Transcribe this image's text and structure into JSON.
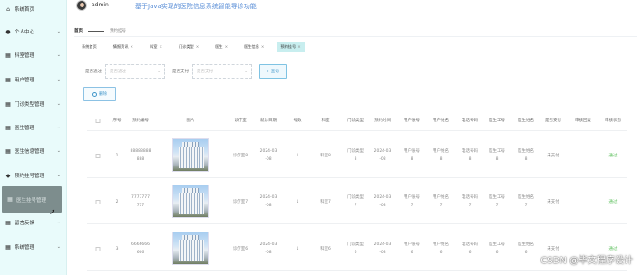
{
  "header": {
    "username": "admin",
    "app_title": "基于Java实现的医院信息系统智能导诊功能"
  },
  "sidebar": {
    "items": [
      {
        "label": "系统首页",
        "icon": "home-icon",
        "glyph": "⌂"
      },
      {
        "label": "个人中心",
        "icon": "user-icon",
        "glyph": "●"
      },
      {
        "label": "科室管理",
        "icon": "grid-icon",
        "glyph": "▦"
      },
      {
        "label": "用户管理",
        "icon": "grid-icon",
        "glyph": "▦"
      },
      {
        "label": "门诊类型管理",
        "icon": "grid-icon",
        "glyph": "▦"
      },
      {
        "label": "医生管理",
        "icon": "grid-icon",
        "glyph": "▦"
      },
      {
        "label": "医生信息管理",
        "icon": "grid-icon",
        "glyph": "▦"
      },
      {
        "label": "预约挂号管理",
        "icon": "bulb-icon",
        "glyph": "◆"
      },
      {
        "label": "医生挂号管理",
        "icon": "grid-icon",
        "glyph": "▦"
      },
      {
        "label": "留言反馈",
        "icon": "grid-icon",
        "glyph": "▦"
      },
      {
        "label": "系统管理",
        "icon": "grid-icon",
        "glyph": "▦"
      }
    ]
  },
  "breadcrumb": {
    "home": "首页",
    "current": "预约挂号"
  },
  "tabs": [
    {
      "label": "系统首页",
      "closable": false
    },
    {
      "label": "情报资讯",
      "closable": true
    },
    {
      "label": "科室",
      "closable": true
    },
    {
      "label": "门诊类型",
      "closable": true
    },
    {
      "label": "医生",
      "closable": true
    },
    {
      "label": "医生信息",
      "closable": true
    },
    {
      "label": "预约挂号",
      "closable": true
    }
  ],
  "filters": {
    "field1_label": "是否通过",
    "field1_placeholder": "是否通过",
    "field2_label": "是否支付",
    "field2_placeholder": "是否支付",
    "search_label": "查询"
  },
  "actions": {
    "delete_label": "删除"
  },
  "table": {
    "columns": [
      "序号",
      "预约编号",
      "图片",
      "诊疗室",
      "就诊日期",
      "号数",
      "科室",
      "门诊类型",
      "预约时间",
      "用户账号",
      "用户姓名",
      "电话号码",
      "医生工号",
      "医生姓名",
      "是否支付",
      "审核回复",
      "审核状态"
    ],
    "rows": [
      {
        "index": "1",
        "order_no": [
          "88888888",
          "888"
        ],
        "room": "诊疗室8",
        "date": [
          "2024-03",
          "-08"
        ],
        "number": "1",
        "dept": "科室8",
        "clinic_type": [
          "门诊类型",
          "8"
        ],
        "time": [
          "2024-03",
          "-08"
        ],
        "account": [
          "用户账号",
          "8"
        ],
        "name": [
          "用户姓名",
          "8"
        ],
        "phone": [
          "电话号码",
          "8"
        ],
        "doc_id": [
          "医生工号",
          "8"
        ],
        "doc_name": [
          "医生姓名",
          "8"
        ],
        "paid": "未支付",
        "reply": "",
        "status": "通过"
      },
      {
        "index": "2",
        "order_no": [
          "7777777",
          "777"
        ],
        "room": "诊疗室7",
        "date": [
          "2024-03",
          "-08"
        ],
        "number": "1",
        "dept": "科室7",
        "clinic_type": [
          "门诊类型",
          "7"
        ],
        "time": [
          "2024-03",
          "-08"
        ],
        "account": [
          "用户账号",
          "7"
        ],
        "name": [
          "用户姓名",
          "7"
        ],
        "phone": [
          "电话号码",
          "7"
        ],
        "doc_id": [
          "医生工号",
          "7"
        ],
        "doc_name": [
          "医生姓名",
          "7"
        ],
        "paid": "未支付",
        "reply": "",
        "status": "通过"
      },
      {
        "index": "3",
        "order_no": [
          "6666666",
          "666"
        ],
        "room": "诊疗室6",
        "date": [
          "2024-03",
          "-08"
        ],
        "number": "1",
        "dept": "科室6",
        "clinic_type": [
          "门诊类型",
          "6"
        ],
        "time": [
          "2024-03",
          "-08"
        ],
        "account": [
          "用户账号",
          "6"
        ],
        "name": [
          "用户姓名",
          "6"
        ],
        "phone": [
          "电话号码",
          "6"
        ],
        "doc_id": [
          "医生工号",
          "6"
        ],
        "doc_name": [
          "医生姓名",
          "6"
        ],
        "paid": "未支付",
        "reply": "",
        "status": "通过"
      }
    ]
  },
  "watermark": "CSDN @毕文程序设计",
  "colors": {
    "sidebar_bg": "#e9fbfb",
    "active_item_bg": "#7d8d8d",
    "title_blue": "#5b8fd7",
    "tab_active_bg": "#c8eeef",
    "status_green": "#5cbf5c"
  }
}
